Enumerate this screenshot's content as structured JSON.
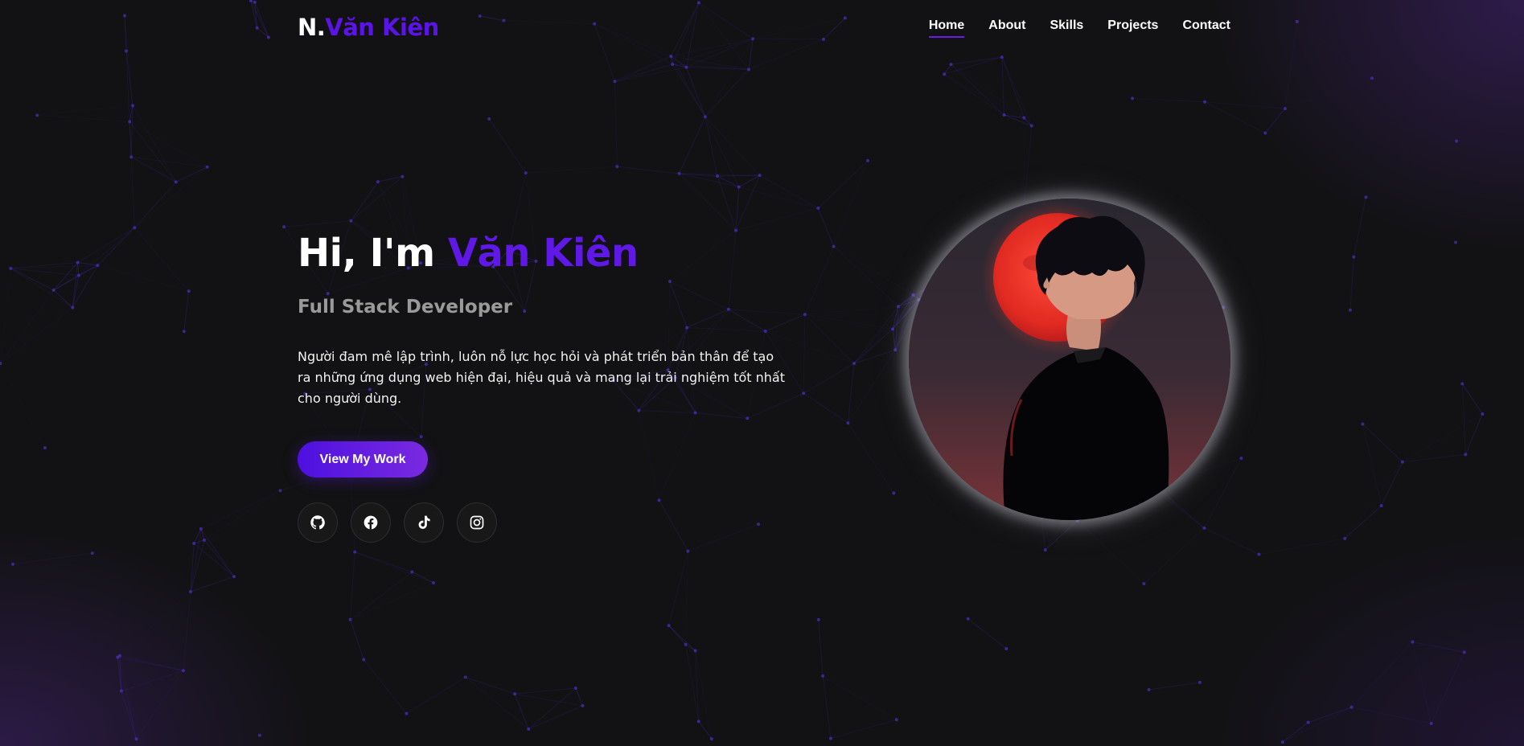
{
  "nav": {
    "logo_prefix": "N.",
    "logo_name": "Văn Kiên",
    "items": [
      {
        "label": "Home",
        "active": true
      },
      {
        "label": "About",
        "active": false
      },
      {
        "label": "Skills",
        "active": false
      },
      {
        "label": "Projects",
        "active": false
      },
      {
        "label": "Contact",
        "active": false
      }
    ]
  },
  "hero": {
    "greeting": "Hi, I'm ",
    "name": "Văn Kiên",
    "subtitle": "Full Stack Developer",
    "description": "Người đam mê lập trình, luôn nỗ lực học hỏi và phát triển bản thân để tạo ra những ứng dụng web hiện đại, hiệu quả và mang lại trải nghiệm tốt nhất cho người dùng.",
    "cta_label": "View My Work"
  },
  "socials": [
    {
      "icon": "github-icon"
    },
    {
      "icon": "facebook-icon"
    },
    {
      "icon": "tiktok-icon"
    },
    {
      "icon": "instagram-icon"
    }
  ],
  "colors": {
    "accent": "#5b14e8",
    "background": "#121214",
    "subtitle": "#9a9a9a"
  }
}
